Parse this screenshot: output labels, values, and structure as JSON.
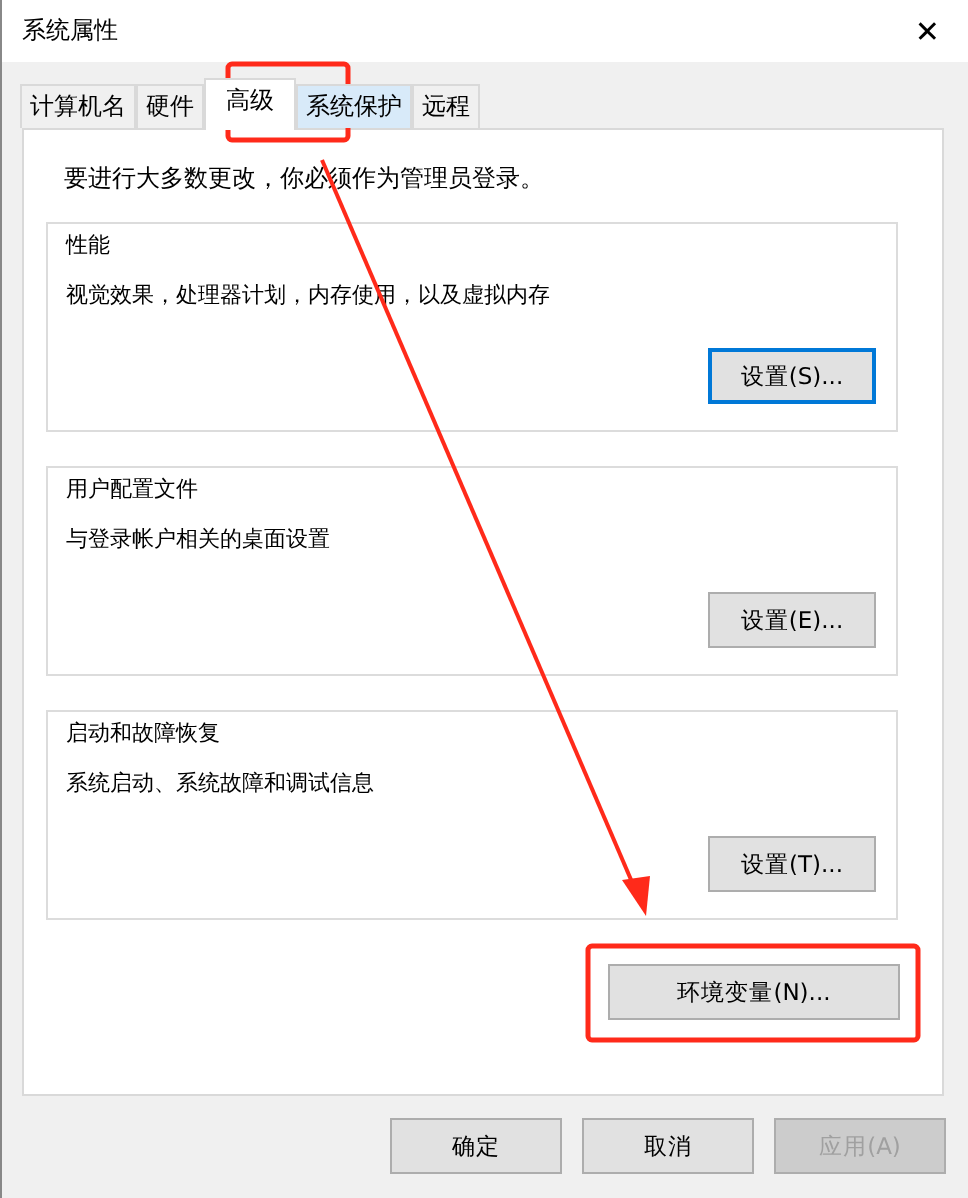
{
  "window": {
    "title": "系统属性",
    "close": "✕"
  },
  "tabs": [
    {
      "label": "计算机名",
      "selected": false,
      "hovered": false
    },
    {
      "label": "硬件",
      "selected": false,
      "hovered": false
    },
    {
      "label": "高级",
      "selected": true,
      "hovered": false
    },
    {
      "label": "系统保护",
      "selected": false,
      "hovered": true
    },
    {
      "label": "远程",
      "selected": false,
      "hovered": false
    }
  ],
  "notice": "要进行大多数更改，你必须作为管理员登录。",
  "groups": [
    {
      "title": "性能",
      "description": "视觉效果，处理器计划，内存使用，以及虚拟内存",
      "button": "设置(S)...",
      "focused": true
    },
    {
      "title": "用户配置文件",
      "description": "与登录帐户相关的桌面设置",
      "button": "设置(E)...",
      "focused": false
    },
    {
      "title": "启动和故障恢复",
      "description": "系统启动、系统故障和调试信息",
      "button": "设置(T)...",
      "focused": false
    }
  ],
  "env_button": "环境变量(N)...",
  "buttons": [
    {
      "label": "确定",
      "disabled": false
    },
    {
      "label": "取消",
      "disabled": false
    },
    {
      "label": "应用(A)",
      "disabled": true
    }
  ]
}
